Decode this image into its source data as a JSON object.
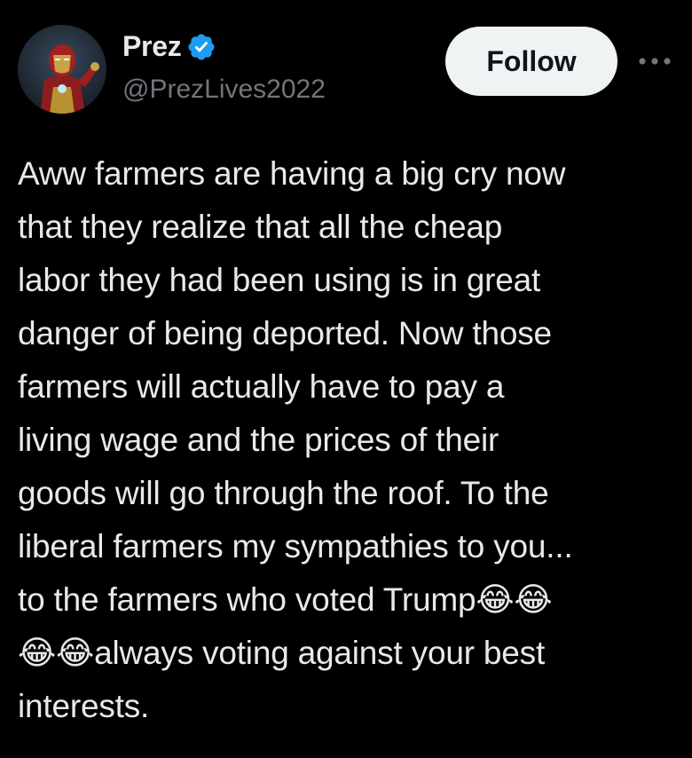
{
  "tweet": {
    "author": {
      "display_name": "Prez",
      "handle": "@PrezLives2022",
      "verified": true,
      "avatar_icon": "iron-man-avatar-icon"
    },
    "follow_label": "Follow",
    "more_icon": "more-dots-icon",
    "text": "Aww farmers are having a big cry now\nthat they realize that all the cheap\nlabor they had been using is in great\ndanger of being deported. Now those\nfarmers will actually have to pay a\nliving wage and the prices of their\ngoods will go through the roof. To the\nliberal farmers my sympathies to you...\nto the farmers who voted Trump😂😂\n😂😂always voting against your best\ninterests."
  },
  "colors": {
    "background": "#000000",
    "text": "#e7e9ea",
    "secondary_text": "#71767b",
    "verified_badge": "#1d9bf0",
    "follow_button_bg": "#eff3f4",
    "follow_button_text": "#0f1419"
  }
}
